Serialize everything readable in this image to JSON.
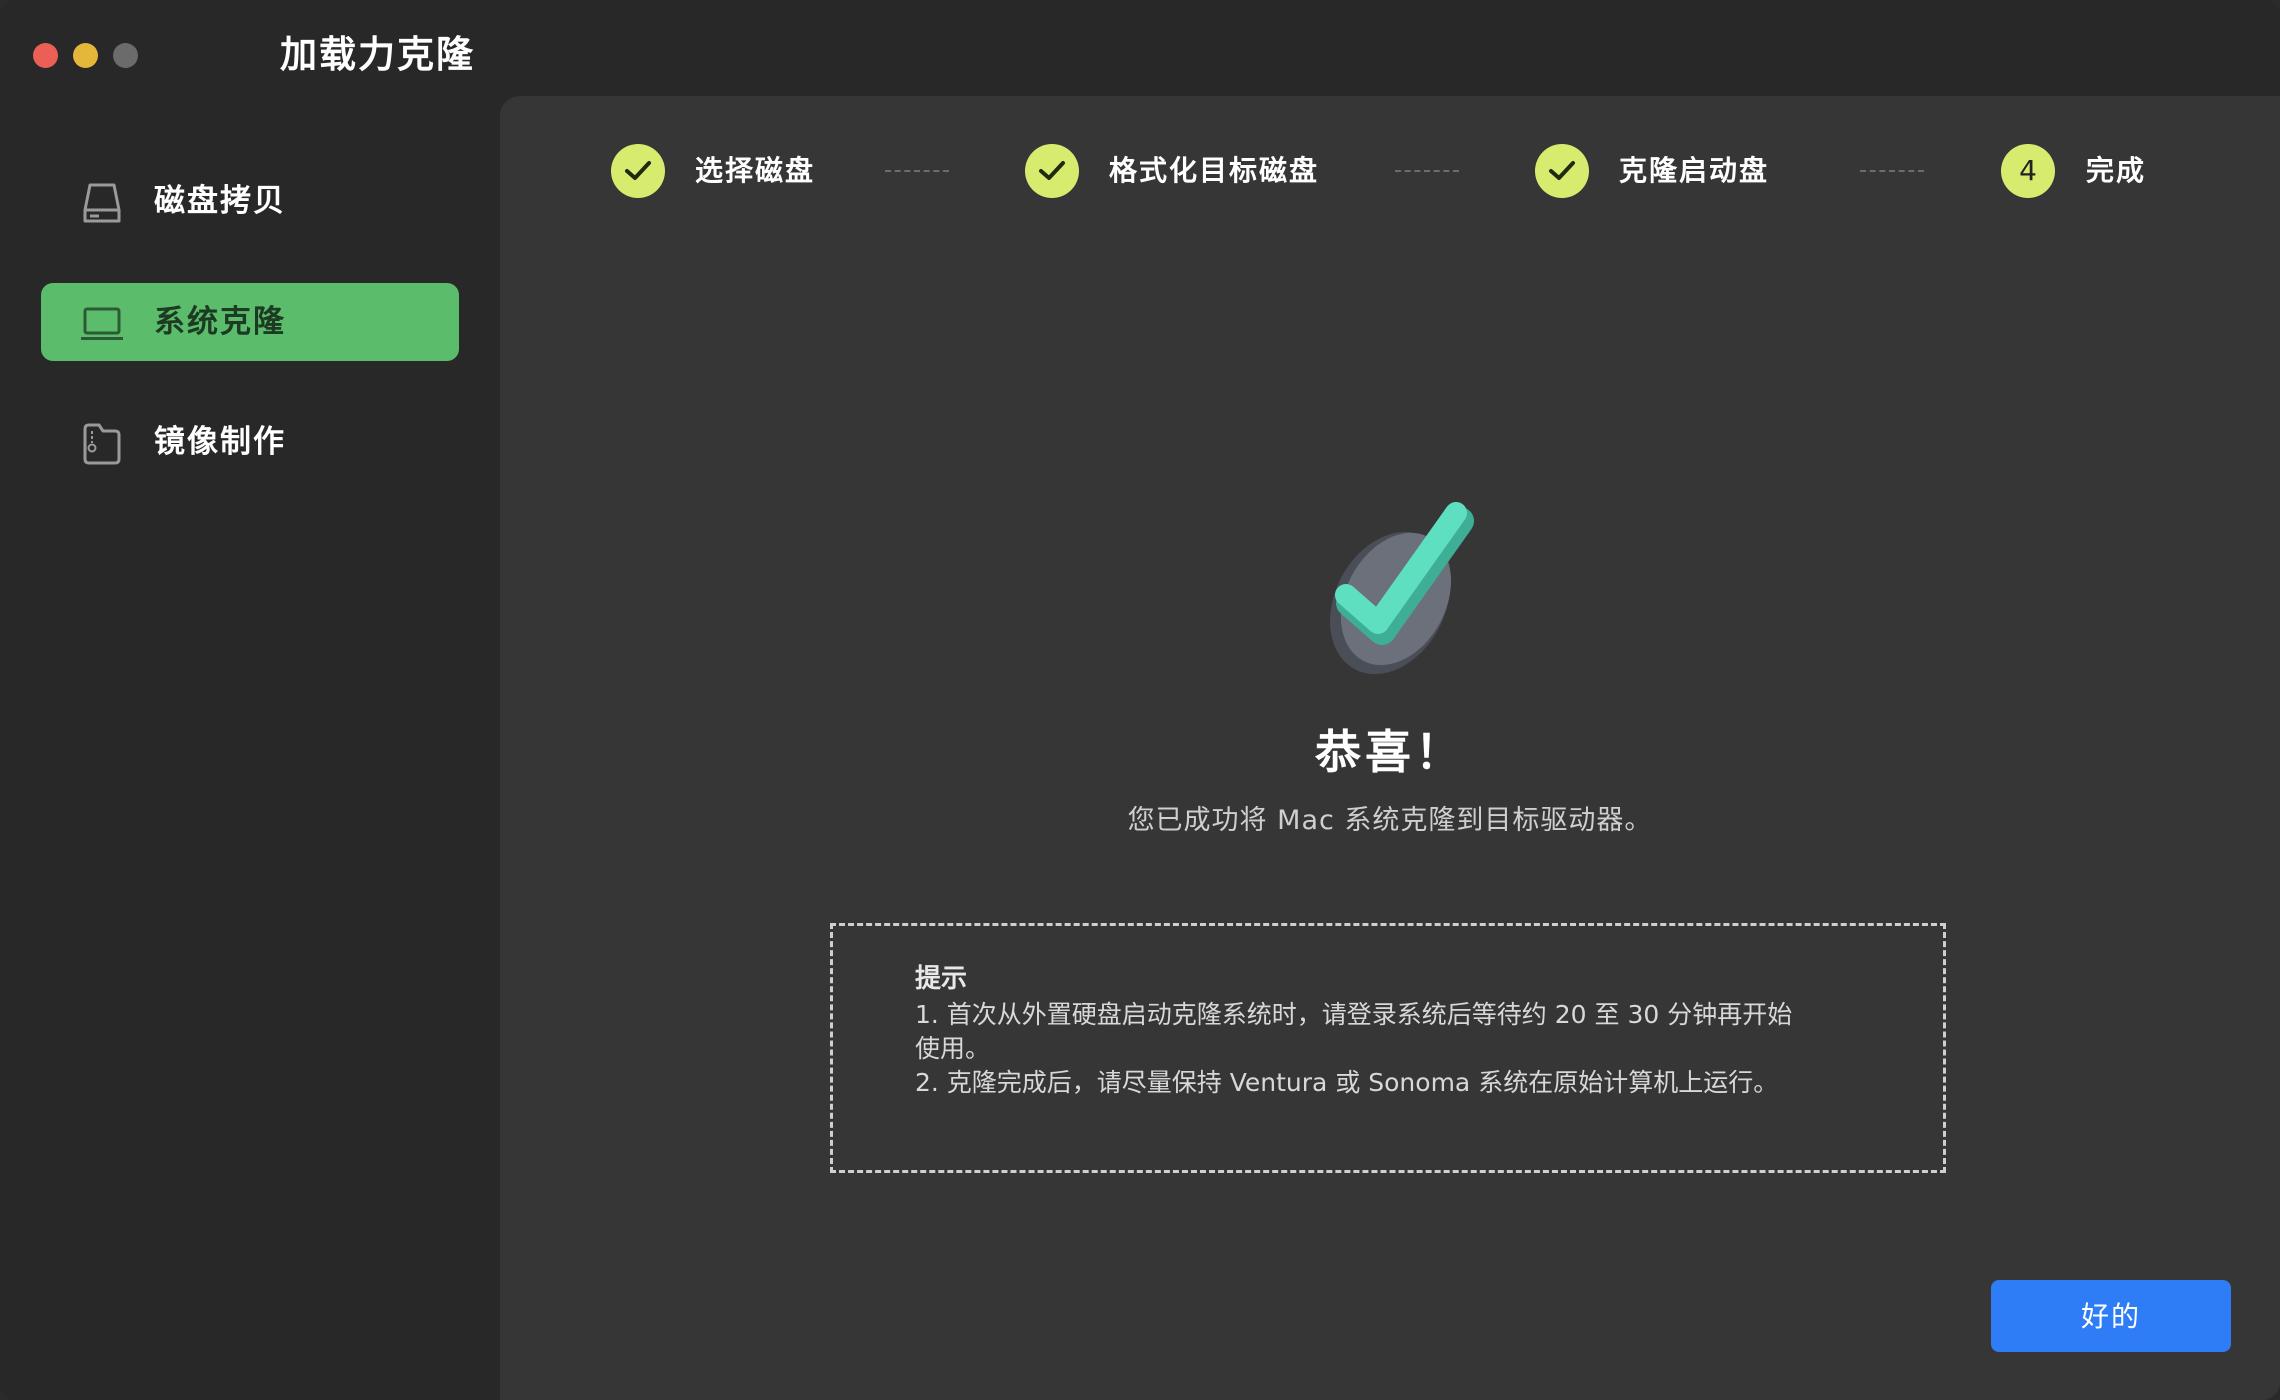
{
  "window": {
    "title": "加载力克隆"
  },
  "sidebar": {
    "items": [
      {
        "label": "磁盘拷贝",
        "icon": "disk-icon",
        "active": false
      },
      {
        "label": "系统克隆",
        "icon": "laptop-icon",
        "active": true
      },
      {
        "label": "镜像制作",
        "icon": "image-file-icon",
        "active": false
      }
    ]
  },
  "steps": [
    {
      "label": "选择磁盘",
      "status": "done"
    },
    {
      "label": "格式化目标磁盘",
      "status": "done"
    },
    {
      "label": "克隆启动盘",
      "status": "done"
    },
    {
      "label": "完成",
      "number": "4",
      "status": "current"
    }
  ],
  "result": {
    "title": "恭喜！",
    "message": "您已成功将 Mac 系统克隆到目标驱动器。"
  },
  "tips": {
    "title": "提示",
    "line1a": "1. 首次从外置硬盘启动克隆系统时，请登录系统后等待约 20 至 30 分钟再开始",
    "line1b": "使用。",
    "line2": "2. 克隆完成后，请尽量保持 Ventura 或 Sonoma 系统在原始计算机上运行。"
  },
  "actions": {
    "ok_label": "好的"
  },
  "colors": {
    "accent_green": "#5bbd6b",
    "step_done": "#d7ec6f",
    "primary_button": "#2e7cf6",
    "check_teal": "#5ee0c0"
  }
}
